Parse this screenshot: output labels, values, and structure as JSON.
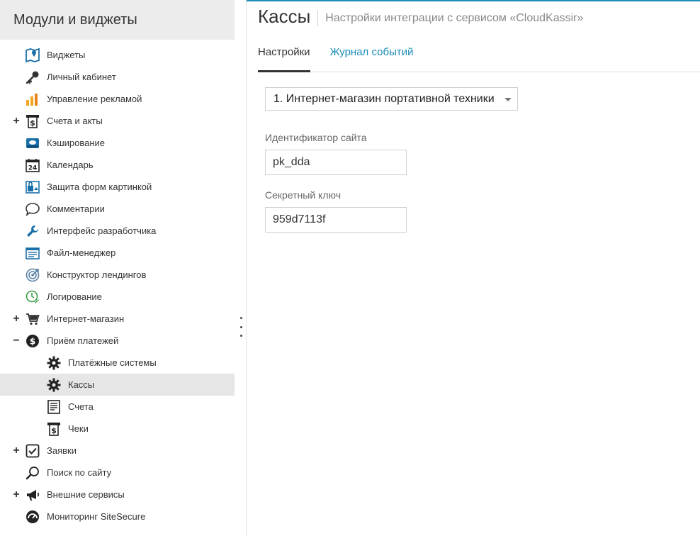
{
  "sidebar": {
    "title": "Модули и виджеты",
    "items": [
      {
        "label": "Виджеты",
        "icon": "map-icon"
      },
      {
        "label": "Личный кабинет",
        "icon": "key-icon"
      },
      {
        "label": "Управление рекламой",
        "icon": "bar-chart-icon"
      },
      {
        "label": "Счета и акты",
        "icon": "receipt-icon",
        "toggle": "+"
      },
      {
        "label": "Кэширование",
        "icon": "disk-icon"
      },
      {
        "label": "Календарь",
        "icon": "calendar-icon",
        "calendar_day": "24"
      },
      {
        "label": "Защита форм картинкой",
        "icon": "lock-image-icon"
      },
      {
        "label": "Комментарии",
        "icon": "speech-bubble-icon"
      },
      {
        "label": "Интерфейс разработчика",
        "icon": "wrench-icon"
      },
      {
        "label": "Файл-менеджер",
        "icon": "file-manager-icon"
      },
      {
        "label": "Конструктор лендингов",
        "icon": "target-icon"
      },
      {
        "label": "Логирование",
        "icon": "clock-pen-icon"
      },
      {
        "label": "Интернет-магазин",
        "icon": "cart-icon",
        "toggle": "+"
      },
      {
        "label": "Приём платежей",
        "icon": "dollar-coin-icon",
        "toggle": "−"
      },
      {
        "label": "Платёжные системы",
        "icon": "gear-icon"
      },
      {
        "label": "Кассы",
        "icon": "gear-icon"
      },
      {
        "label": "Счета",
        "icon": "document-icon"
      },
      {
        "label": "Чеки",
        "icon": "receipt-icon"
      },
      {
        "label": "Заявки",
        "icon": "checkbox-icon",
        "toggle": "+"
      },
      {
        "label": "Поиск по сайту",
        "icon": "magnifier-icon"
      },
      {
        "label": "Внешние сервисы",
        "icon": "megaphone-icon",
        "toggle": "+"
      },
      {
        "label": "Мониторинг SiteSecure",
        "icon": "gauge-icon"
      }
    ]
  },
  "page": {
    "title": "Кассы",
    "subtitle": "Настройки интеграции с сервисом «CloudKassir»"
  },
  "tabs": [
    "Настройки",
    "Журнал событий"
  ],
  "store_select": {
    "value": "1. Интернет-магазин портативной техники"
  },
  "fields": {
    "site_id": {
      "label": "Идентификатор сайта",
      "value": "pk_dda"
    },
    "secret_key": {
      "label": "Секретный ключ",
      "value": "959d7113f"
    }
  },
  "colors": {
    "accent": "#1a8bb8",
    "active_row": "#e6e6e6",
    "header_bg": "#ececec"
  }
}
